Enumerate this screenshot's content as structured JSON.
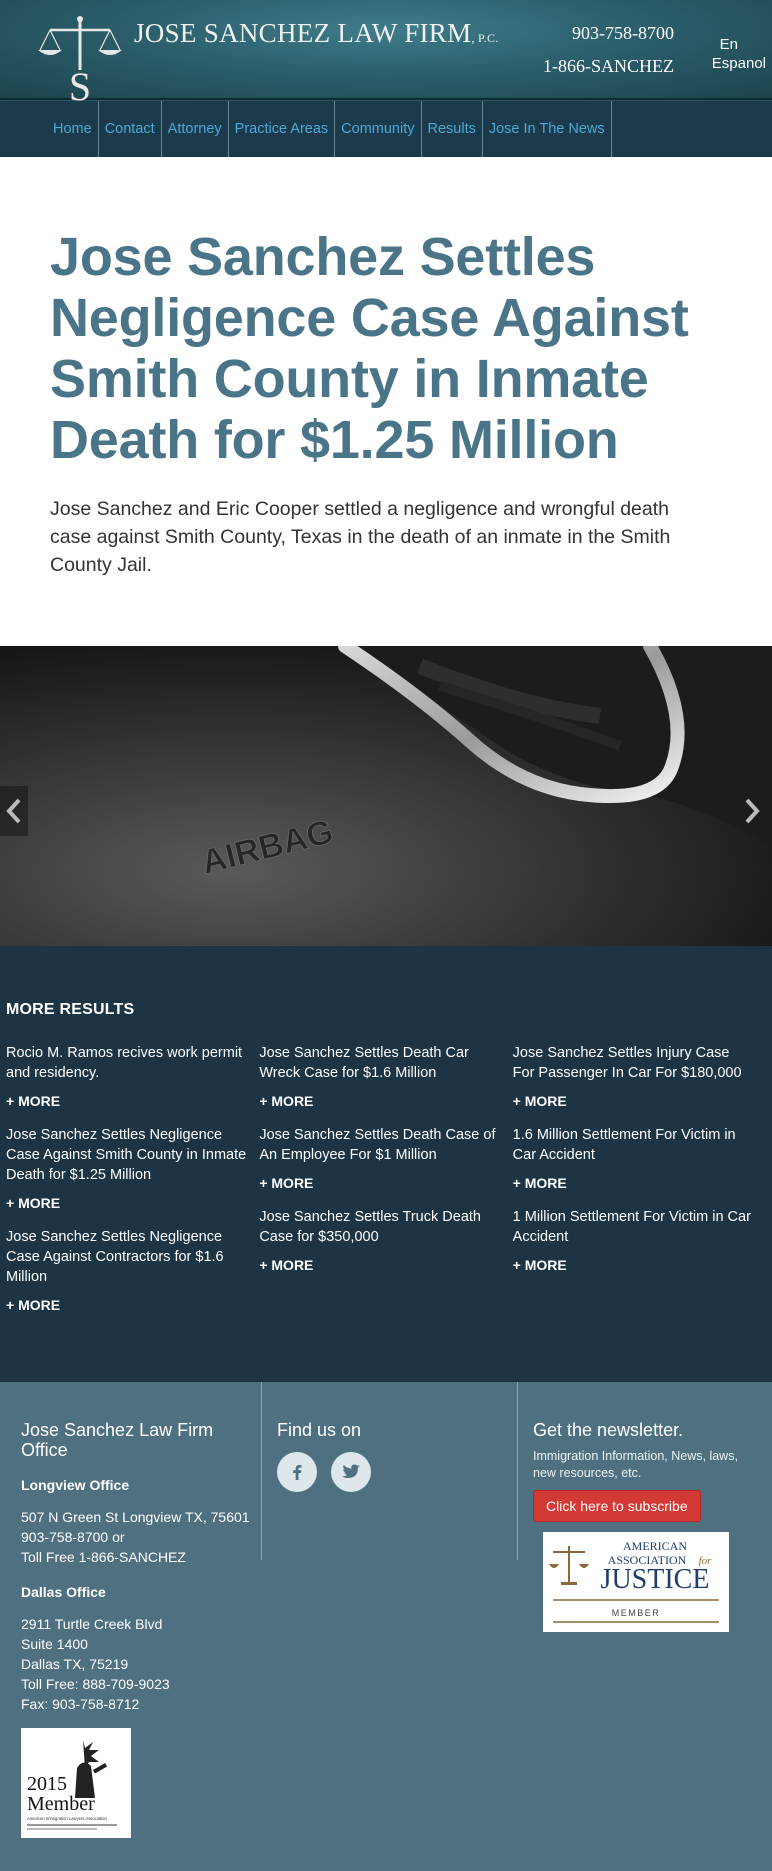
{
  "header": {
    "firm_name": "JOSE SANCHEZ LAW FIRM",
    "firm_suffix": "P.C.",
    "phone_local": "903-758-8700",
    "phone_tollfree": "1-866-SANCHEZ",
    "lang_en": "En",
    "lang_es": "Espanol"
  },
  "nav": {
    "items": [
      "Home",
      "Contact",
      "Attorney",
      "Practice Areas",
      "Community",
      "Results",
      "Jose In The News"
    ]
  },
  "article": {
    "headline": "Jose Sanchez Settles Negligence Case Against Smith County in Inmate Death for $1.25 Million",
    "summary": "Jose Sanchez and Eric Cooper settled a negligence and wrongful death case against Smith County, Texas in the death of an inmate in the Smith County Jail."
  },
  "carousel": {
    "photo_text": "AIRBAG",
    "prev_icon": "chevron-left-icon",
    "next_icon": "chevron-right-icon"
  },
  "more_results": {
    "heading": "MORE RESULTS",
    "more_label": "+ MORE",
    "columns": [
      [
        "Rocio M. Ramos recives work permit and residency.",
        "Jose Sanchez Settles Negligence Case Against Smith County in Inmate Death for $1.25 Million",
        "Jose Sanchez Settles Negligence Case Against Contractors for $1.6 Million"
      ],
      [
        "Jose Sanchez Settles Death Car Wreck Case for $1.6 Million",
        "Jose Sanchez Settles Death Case of An Employee For $1 Million",
        "Jose Sanchez Settles Truck Death Case for $350,000"
      ],
      [
        "Jose Sanchez Settles Injury Case For Passenger In Car For $180,000",
        "1.6 Million Settlement For Victim in Car Accident",
        "1 Million Settlement For Victim in Car Accident"
      ]
    ]
  },
  "footer": {
    "office_heading": "Jose Sanchez Law Firm Office",
    "longview_heading": "Longview Office",
    "longview_lines": [
      "507 N Green St Longview TX, 75601",
      "903-758-8700 or",
      "Toll Free 1-866-SANCHEZ"
    ],
    "dallas_heading": "Dallas Office",
    "dallas_lines": [
      "2911 Turtle Creek Blvd",
      "Suite 1400",
      "Dallas TX, 75219",
      "Toll Free: 888-709-9023",
      "Fax: 903-758-8712"
    ],
    "member_badge": {
      "year": "2015",
      "label": "Member",
      "org": "American Immigration Lawyers Association"
    },
    "find_us": "Find us on",
    "social_icons": [
      "facebook-icon",
      "twitter-icon"
    ],
    "newsletter_heading": "Get the newsletter.",
    "newsletter_text": "Immigration Information, News, laws, new resources, etc.",
    "subscribe_label": "Click here to subscribe",
    "aaj_badge": {
      "line1": "AMERICAN",
      "line2": "ASSOCIATION",
      "for": "for",
      "line3": "JUSTICE",
      "member": "MEMBER"
    }
  },
  "colors": {
    "header_teal": "#2c5f6c",
    "nav_bg": "#1b3b4c",
    "nav_link": "#4da9d6",
    "headline": "#4a7487",
    "results_bg": "#1d3445",
    "footer_bg": "#4f7080",
    "subscribe": "#d33a35"
  }
}
